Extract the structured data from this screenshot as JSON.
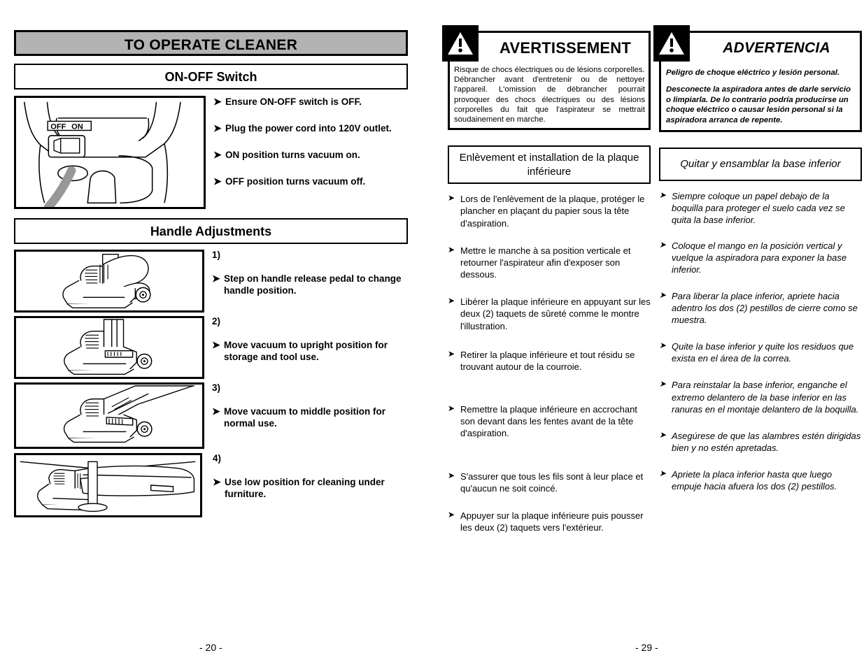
{
  "english": {
    "banner_title": "TO OPERATE CLEANER",
    "section_onoff": {
      "title": "ON-OFF Switch",
      "figure_labels": {
        "off": "OFF",
        "on": "ON"
      },
      "bullets": [
        "Ensure ON-OFF switch is OFF.",
        "Plug the power cord into 120V outlet.",
        "ON position turns vacuum on.",
        "OFF position turns vacuum off."
      ]
    },
    "section_handle": {
      "title": "Handle Adjustments",
      "steps": [
        {
          "number": "1)",
          "text": "Step on handle release pedal to change handle position."
        },
        {
          "number": "2)",
          "text": "Move vacuum to upright position for storage and tool use."
        },
        {
          "number": "3)",
          "text": "Move vacuum to middle position for normal use."
        },
        {
          "number": "4)",
          "text": "Use low position for cleaning under furniture."
        }
      ]
    },
    "page_number": "- 20 -"
  },
  "french": {
    "warning": {
      "title": "AVERTISSEMENT",
      "paragraphs": [
        "Risque de chocs électriques ou de lésions corporelles.",
        "Débrancher avant d'entretenir ou de nettoyer l'appareil. L'omission de débrancher pourrait provoquer des chocs électriques ou des lésions corporelles du fait que l'aspirateur se mettrait soudainement en marche."
      ]
    },
    "section_title": "Enlèvement et installation de la plaque inférieure",
    "bullets": [
      "Lors de l'enlèvement de la plaque, protéger le plancher en plaçant du papier sous la tête d'aspiration.",
      "Mettre le manche à sa position verticale et retourner l'aspirateur afin d'exposer son dessous.",
      "Libérer la plaque inférieure en appuyant sur les deux (2) taquets de sûreté comme le montre l'illustration.",
      "Retirer la plaque inférieure et tout résidu se trouvant autour de la courroie.",
      "Remettre la plaque inférieure en accrochant son devant dans les fentes avant de la tête d'aspiration.",
      "S'assurer que tous les fils sont à leur place et qu'aucun ne soit coincé.",
      "Appuyer sur la plaque inférieure puis pousser les deux (2) taquets vers l'extérieur."
    ]
  },
  "spanish": {
    "warning": {
      "title": "ADVERTENCIA",
      "paragraphs": [
        "Peligro de choque eléctrico y lesión personal.",
        "Desconecte la aspiradora antes de darle servicio o limpiarla.  De lo contrario podría producirse un choque eléctrico o causar lesión personal si la aspiradora arranca de repente."
      ]
    },
    "section_title": "Quitar y ensamblar la base inferior",
    "bullets": [
      "Siempre coloque un papel debajo de la boquilla para proteger el suelo cada vez se quita la base inferior.",
      "Coloque el mango en la posición vertical y vuelque la aspiradora para exponer la base inferior.",
      "Para liberar la place inferior, apriete hacia adentro los dos (2) pestillos de cierre como se muestra.",
      "Quite la base inferior y quite los residuos que exista en el área de la correa.",
      "Para reinstalar la base inferior, enganche el extremo delantero de la base inferior en las ranuras en el montaje delantero de la boquilla.",
      "Asegúrese de que las alambres estén dirigidas bien y no estén apretadas.",
      "Apriete la placa inferior hasta que luego empuje hacia afuera los dos (2) pestillos."
    ],
    "page_number": "- 29 -"
  },
  "icons": {
    "bullet_arrow": "➤",
    "warning_triangle": "warning-triangle-icon"
  },
  "colors": {
    "banner_fill": "#b3b3b3",
    "rule": "#000000",
    "page_bg": "#ffffff",
    "cord_gray": "#a6a6a6"
  }
}
